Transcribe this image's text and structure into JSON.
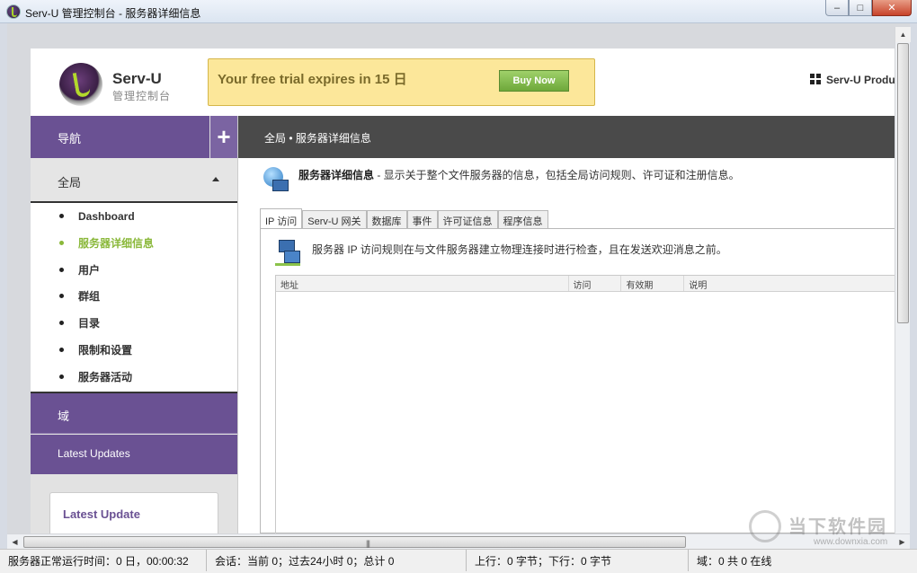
{
  "window": {
    "title": "Serv-U 管理控制台 - 服务器详细信息",
    "buttons": {
      "minimize": "–",
      "maximize": "□",
      "close": "✕"
    }
  },
  "header": {
    "logo_name": "Serv-U",
    "logo_sub": "管理控制台",
    "trial_message": "Your free trial expires in 15 日",
    "buy_now": "Buy Now",
    "products": "Serv-U Produ"
  },
  "sidebar": {
    "nav_label": "导航",
    "plus": "+",
    "global_label": "全局",
    "items": [
      {
        "label": "Dashboard",
        "active": false
      },
      {
        "label": "服务器详细信息",
        "active": true
      },
      {
        "label": "用户",
        "active": false
      },
      {
        "label": "群组",
        "active": false
      },
      {
        "label": "目录",
        "active": false
      },
      {
        "label": "限制和设置",
        "active": false
      },
      {
        "label": "服务器活动",
        "active": false
      }
    ],
    "domain_label": "域",
    "latest_updates_label": "Latest Updates",
    "latest_update_card": {
      "title": "Latest Update"
    }
  },
  "main": {
    "breadcrumb": "全局 • 服务器详细信息",
    "desc_title": "服务器详细信息",
    "desc_text": " - 显示关于整个文件服务器的信息，包括全局访问规则、许可证和注册信息。",
    "tabs": [
      {
        "label": "IP 访问",
        "active": true
      },
      {
        "label": "Serv-U 网关",
        "active": false
      },
      {
        "label": "数据库",
        "active": false
      },
      {
        "label": "事件",
        "active": false
      },
      {
        "label": "许可证信息",
        "active": false
      },
      {
        "label": "程序信息",
        "active": false
      }
    ],
    "panel_desc": "服务器 IP 访问规则在与文件服务器建立物理连接时进行检查，且在发送欢迎消息之前。",
    "table_columns": [
      "地址",
      "访问",
      "有效期",
      "说明"
    ]
  },
  "statusbar": {
    "uptime": "服务器正常运行时间：0 日，00:00:32",
    "sessions": "会话：当前 0；过去24小时 0；总计 0",
    "transfer": "上行：0 字节；下行：0 字节",
    "domains": "域：0 共 0 在线"
  },
  "watermark": {
    "text": "当下软件园",
    "url": "www.downxia.com"
  }
}
